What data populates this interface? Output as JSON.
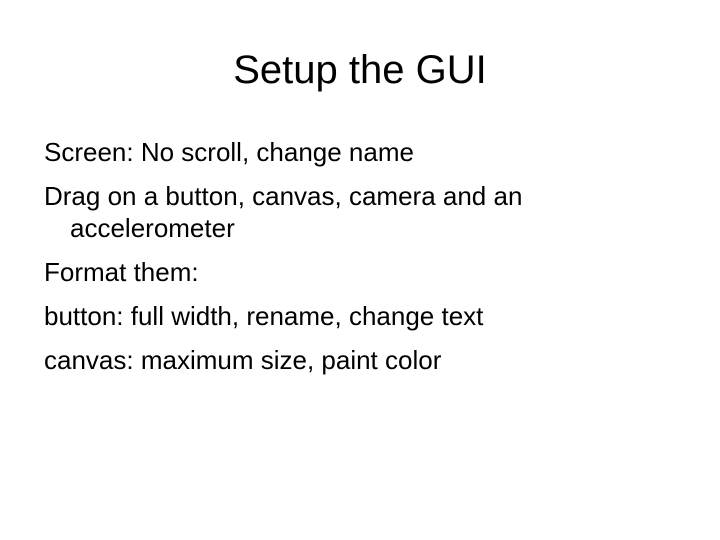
{
  "slide": {
    "title": "Setup the GUI",
    "bullets": [
      "Screen: No scroll, change name",
      "Drag on a button, canvas, camera and an accelerometer",
      "Format them:",
      "button: full width, rename, change text",
      "canvas: maximum size, paint color"
    ]
  }
}
